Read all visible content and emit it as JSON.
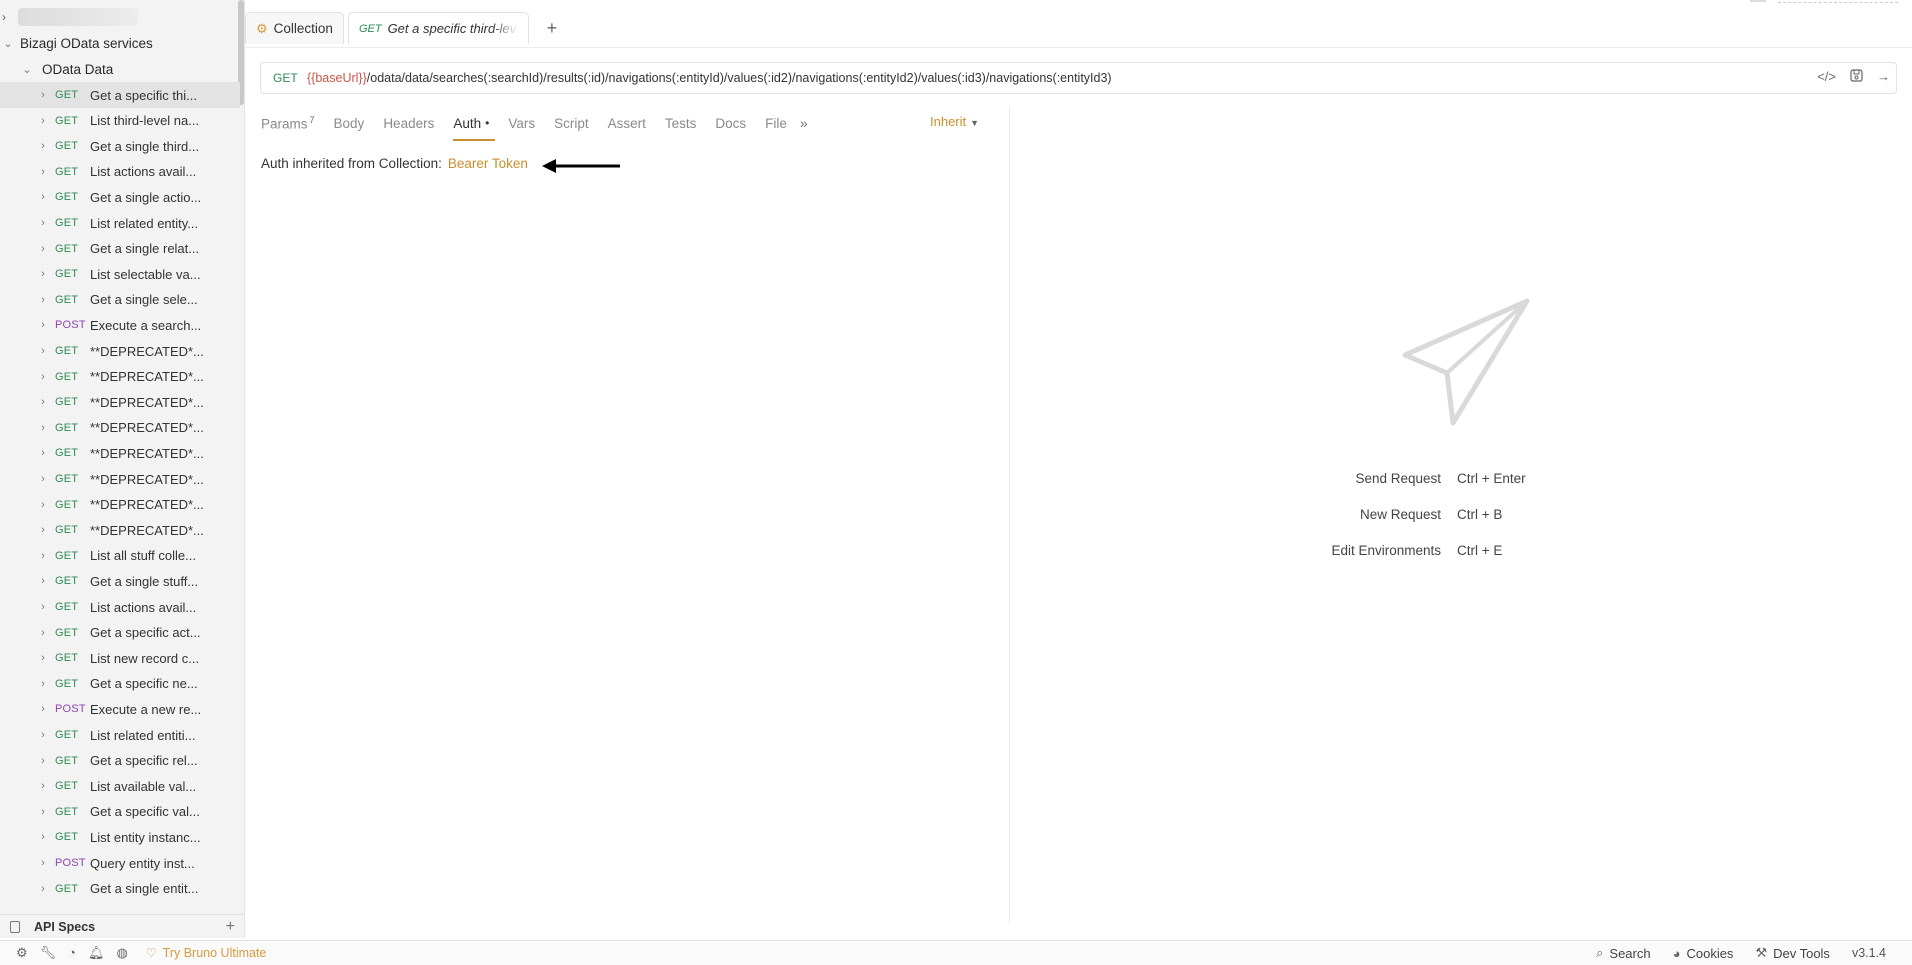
{
  "sidebar": {
    "collection_name": "Bizagi OData services",
    "folder_name": "OData Data",
    "requests": [
      {
        "method": "GET",
        "name": "Get a specific thi..."
      },
      {
        "method": "GET",
        "name": "List third-level na..."
      },
      {
        "method": "GET",
        "name": "Get a single third..."
      },
      {
        "method": "GET",
        "name": "List actions avail..."
      },
      {
        "method": "GET",
        "name": "Get a single actio..."
      },
      {
        "method": "GET",
        "name": "List related entity..."
      },
      {
        "method": "GET",
        "name": "Get a single relat..."
      },
      {
        "method": "GET",
        "name": "List selectable va..."
      },
      {
        "method": "GET",
        "name": "Get a single sele..."
      },
      {
        "method": "POST",
        "name": "Execute a search..."
      },
      {
        "method": "GET",
        "name": "**DEPRECATED*..."
      },
      {
        "method": "GET",
        "name": "**DEPRECATED*..."
      },
      {
        "method": "GET",
        "name": "**DEPRECATED*..."
      },
      {
        "method": "GET",
        "name": "**DEPRECATED*..."
      },
      {
        "method": "GET",
        "name": "**DEPRECATED*..."
      },
      {
        "method": "GET",
        "name": "**DEPRECATED*..."
      },
      {
        "method": "GET",
        "name": "**DEPRECATED*..."
      },
      {
        "method": "GET",
        "name": "**DEPRECATED*..."
      },
      {
        "method": "GET",
        "name": "List all stuff colle..."
      },
      {
        "method": "GET",
        "name": "Get a single stuff..."
      },
      {
        "method": "GET",
        "name": "List actions avail..."
      },
      {
        "method": "GET",
        "name": "Get a specific act..."
      },
      {
        "method": "GET",
        "name": "List new record c..."
      },
      {
        "method": "GET",
        "name": "Get a specific ne..."
      },
      {
        "method": "POST",
        "name": "Execute a new re..."
      },
      {
        "method": "GET",
        "name": "List related entiti..."
      },
      {
        "method": "GET",
        "name": "Get a specific rel..."
      },
      {
        "method": "GET",
        "name": "List available val..."
      },
      {
        "method": "GET",
        "name": "Get a specific val..."
      },
      {
        "method": "GET",
        "name": "List entity instanc..."
      },
      {
        "method": "POST",
        "name": "Query entity inst..."
      },
      {
        "method": "GET",
        "name": "Get a single entit..."
      }
    ],
    "api_specs_label": "API Specs"
  },
  "tabs": {
    "collection_label": "Collection",
    "request_method": "GET",
    "request_title": "Get a specific third-level"
  },
  "url": {
    "method": "GET",
    "variable": "{{baseUrl}}",
    "path": "/odata/data/searches(:searchId)/results(:id)/navigations(:entityId)/values(:id2)/navigations(:entityId2)/values(:id3)/navigations(:entityId3)"
  },
  "request_tabs": {
    "params": "Params",
    "params_count": "7",
    "body": "Body",
    "headers": "Headers",
    "auth": "Auth",
    "vars": "Vars",
    "script": "Script",
    "assert": "Assert",
    "tests": "Tests",
    "docs": "Docs",
    "file": "File"
  },
  "auth_mode": "Inherit",
  "auth_text": "Auth inherited from Collection:",
  "auth_type": "Bearer Token",
  "shortcuts": [
    {
      "label": "Send Request",
      "keys": "Ctrl + Enter"
    },
    {
      "label": "New Request",
      "keys": "Ctrl + B"
    },
    {
      "label": "Edit Environments",
      "keys": "Ctrl + E"
    }
  ],
  "statusbar": {
    "promo": "Try Bruno Ultimate",
    "search": "Search",
    "cookies": "Cookies",
    "dev_tools": "Dev Tools",
    "version": "v3.1.4"
  },
  "colors": {
    "accent": "#c98f2e",
    "get": "#2e8b57",
    "post": "#8e44ad"
  }
}
